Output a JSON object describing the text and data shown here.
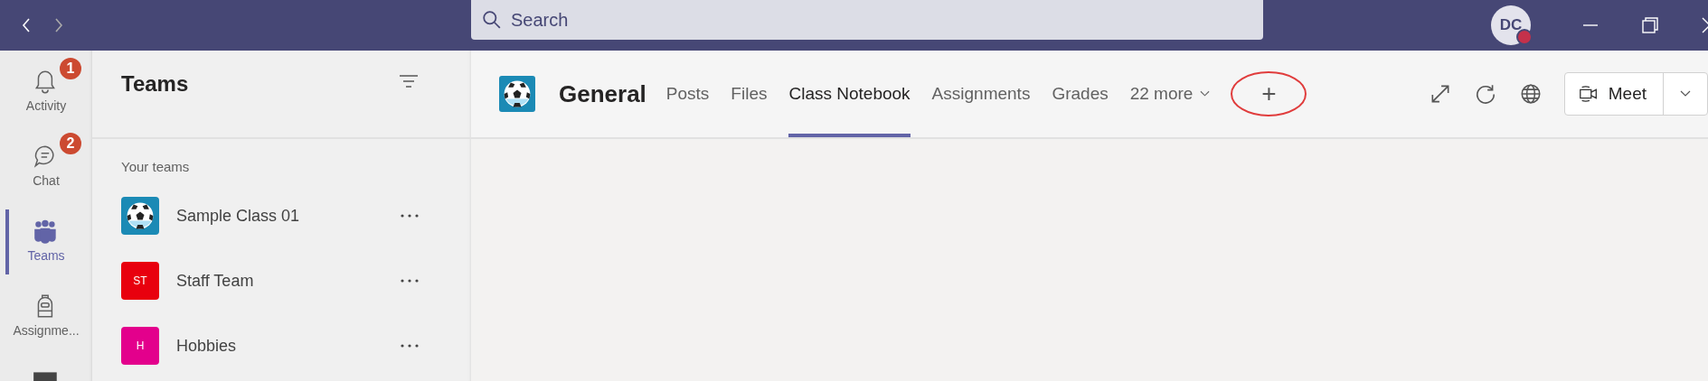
{
  "title_bar": {
    "search": {
      "placeholder": "Search"
    },
    "account": {
      "initials": "DC",
      "status_dot": {
        "color": "#c4314b"
      }
    }
  },
  "app_bar": [
    {
      "label": "Activity",
      "badge": "1",
      "selected": false
    },
    {
      "label": "Chat",
      "badge": "2",
      "selected": false
    },
    {
      "label": "Teams",
      "selected": true
    },
    {
      "label": "Assignme...",
      "selected": false
    },
    {
      "selected": false
    }
  ],
  "teams_panel": {
    "title": "Teams",
    "section": "Your teams",
    "teams": [
      {
        "name": "Sample Class 01",
        "kind": "icon",
        "color": "#1b8ab5"
      },
      {
        "name": "Staff Team",
        "kind": "initials",
        "initials": "ST",
        "color": "#e8000e"
      },
      {
        "name": "Hobbies",
        "kind": "initials",
        "initials": "H",
        "color": "#e3008c"
      }
    ]
  },
  "channel_header": {
    "title": "General",
    "tabs": [
      {
        "label": "Posts",
        "selected": false
      },
      {
        "label": "Files",
        "selected": false
      },
      {
        "label": "Class Notebook",
        "selected": true
      },
      {
        "label": "Assignments",
        "selected": false
      },
      {
        "label": "Grades",
        "selected": false
      }
    ],
    "more_tabs": "22 more",
    "add_tab": {
      "label": "+",
      "circled": true
    },
    "meet_button": "Meet"
  }
}
